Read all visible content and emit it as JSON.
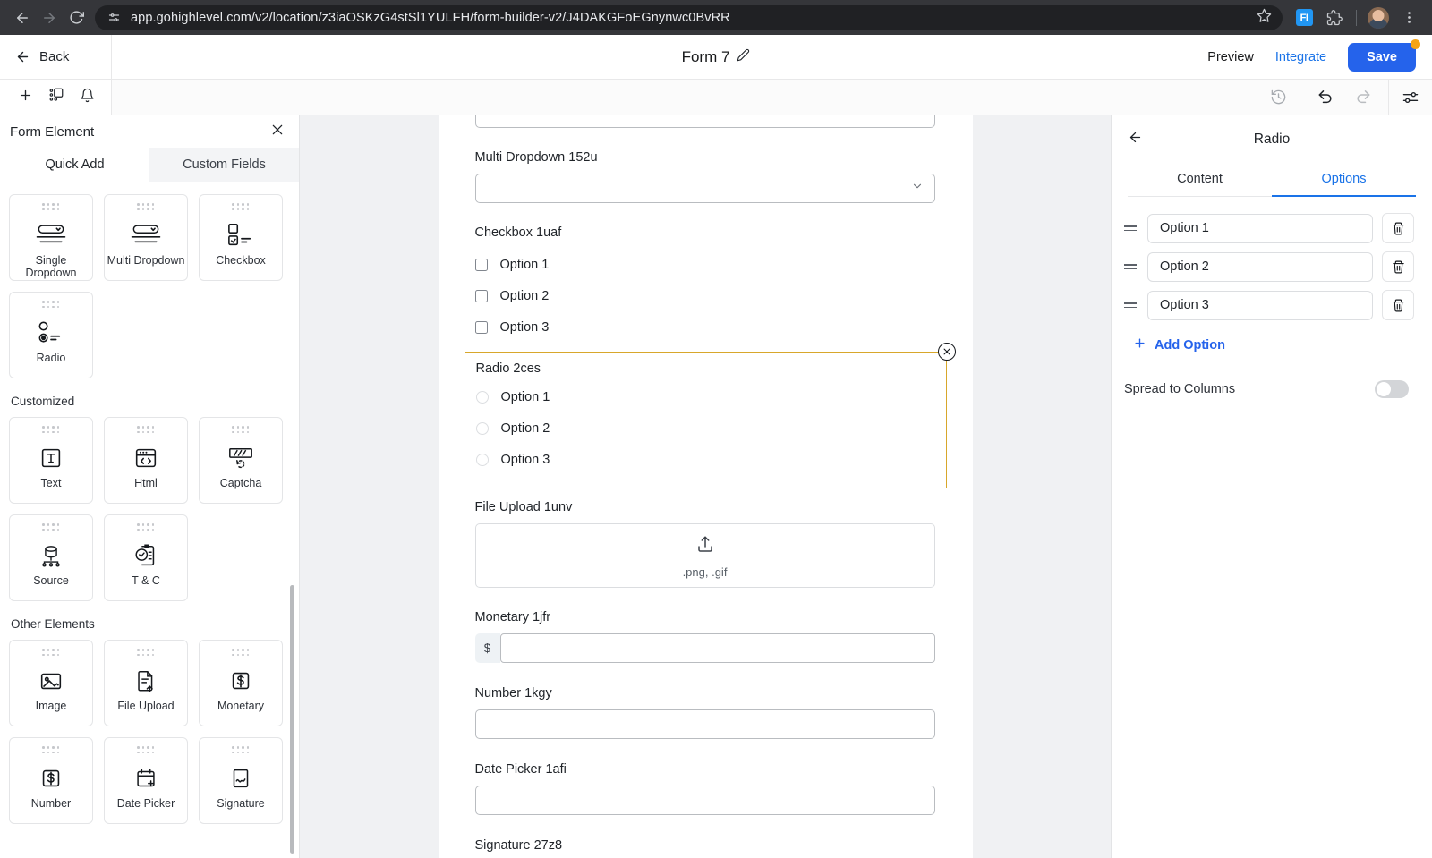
{
  "browser": {
    "url": "app.gohighlevel.com/v2/location/z3iaOSKzG4stSl1YULFH/form-builder-v2/J4DAKGFoEGnynwc0BvRR",
    "extension_label": "FI"
  },
  "header": {
    "back_label": "Back",
    "form_title": "Form 7",
    "preview_label": "Preview",
    "integrate_label": "Integrate",
    "save_label": "Save"
  },
  "left_panel": {
    "title": "Form Element",
    "tabs": [
      {
        "label": "Quick Add",
        "active": true
      },
      {
        "label": "Custom Fields",
        "active": false
      }
    ],
    "groups": [
      {
        "title": "",
        "items": [
          {
            "label": "Single Dropdown",
            "icon": "single-dropdown-icon"
          },
          {
            "label": "Multi Dropdown",
            "icon": "multi-dropdown-icon"
          },
          {
            "label": "Checkbox",
            "icon": "checkbox-icon"
          },
          {
            "label": "Radio",
            "icon": "radio-icon"
          }
        ]
      },
      {
        "title": "Customized",
        "items": [
          {
            "label": "Text",
            "icon": "text-icon"
          },
          {
            "label": "Html",
            "icon": "html-icon"
          },
          {
            "label": "Captcha",
            "icon": "captcha-icon"
          },
          {
            "label": "Source",
            "icon": "source-icon"
          },
          {
            "label": "T & C",
            "icon": "terms-icon"
          }
        ]
      },
      {
        "title": "Other Elements",
        "items": [
          {
            "label": "Image",
            "icon": "image-icon"
          },
          {
            "label": "File Upload",
            "icon": "file-upload-icon"
          },
          {
            "label": "Monetary",
            "icon": "monetary-icon"
          },
          {
            "label": "Number",
            "icon": "number-icon"
          },
          {
            "label": "Date Picker",
            "icon": "date-picker-icon"
          },
          {
            "label": "Signature",
            "icon": "signature-icon"
          }
        ]
      }
    ]
  },
  "canvas": {
    "fields": {
      "dropdown_top_label": "",
      "multi_dropdown_label": "Multi Dropdown 152u",
      "checkbox_label": "Checkbox 1uaf",
      "checkbox_options": [
        "Option 1",
        "Option 2",
        "Option 3"
      ],
      "radio_label": "Radio 2ces",
      "radio_options": [
        "Option 1",
        "Option 2",
        "Option 3"
      ],
      "file_upload_label": "File Upload 1unv",
      "file_upload_hint": ".png, .gif",
      "monetary_label": "Monetary 1jfr",
      "monetary_prefix": "$",
      "number_label": "Number 1kgy",
      "date_picker_label": "Date Picker 1afi",
      "signature_label": "Signature 27z8"
    },
    "selection_color": "#d8a72b"
  },
  "right_panel": {
    "title": "Radio",
    "tabs": [
      {
        "label": "Content",
        "active": false
      },
      {
        "label": "Options",
        "active": true
      }
    ],
    "options": [
      "Option 1",
      "Option 2",
      "Option 3"
    ],
    "add_option_label": "Add Option",
    "spread_label": "Spread to Columns",
    "spread_enabled": false,
    "accent_color": "#1a73e8"
  }
}
